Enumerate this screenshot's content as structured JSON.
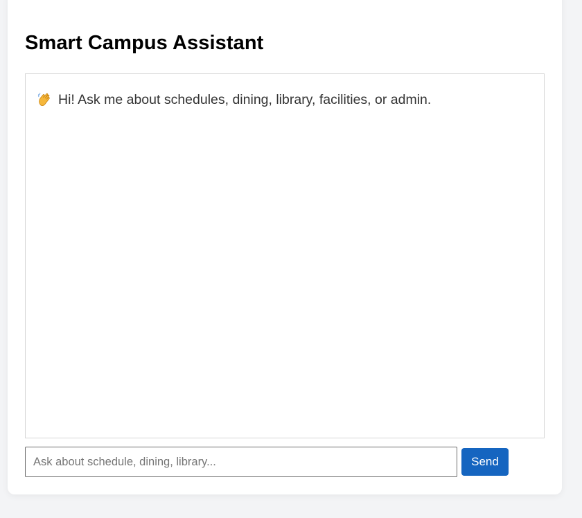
{
  "app": {
    "title": "Smart Campus Assistant"
  },
  "chat": {
    "messages": [
      {
        "icon": "waving-hand-icon",
        "text": "Hi! Ask me about schedules, dining, library, facilities, or admin."
      }
    ]
  },
  "input": {
    "value": "",
    "placeholder": "Ask about schedule, dining, library..."
  },
  "send": {
    "label": "Send"
  },
  "colors": {
    "background": "#f3f4f6",
    "card": "#ffffff",
    "accent": "#1565c0",
    "text": "#333333"
  }
}
